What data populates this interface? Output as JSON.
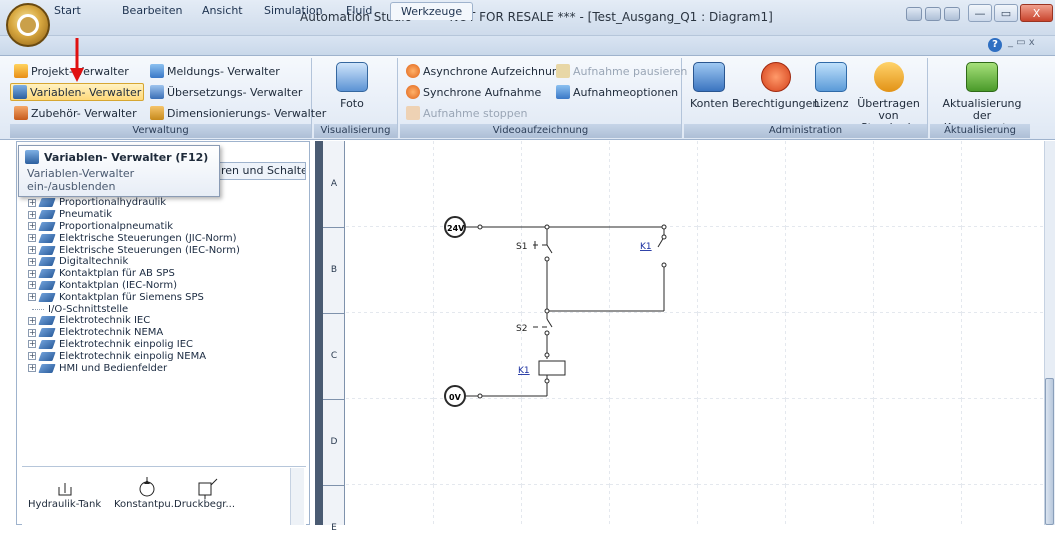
{
  "window": {
    "title": "Automation Studio™  *** NOT FOR RESALE ***   - [Test_Ausgang_Q1 : Diagram1]",
    "minimize": "—",
    "maximize": "▭",
    "close": "X"
  },
  "menu_tabs": [
    "Start",
    "Bearbeiten",
    "Ansicht",
    "Simulation",
    "Fluid",
    "Werkzeuge"
  ],
  "active_tab": "Werkzeuge",
  "ribbon": {
    "verwaltung": {
      "label": "Verwaltung",
      "items": [
        "Projekt- Verwalter",
        "Meldungs- Verwalter",
        "Variablen- Verwalter",
        "Übersetzungs- Verwalter",
        "Zubehör- Verwalter",
        "Dimensionierungs- Verwalter"
      ]
    },
    "visualisierung": {
      "label": "Visualisierung",
      "foto": "Foto"
    },
    "videoaufzeichnung": {
      "label": "Videoaufzeichnung",
      "async": "Asynchrone Aufzeichnung",
      "pause": "Aufnahme pausieren",
      "sync": "Synchrone Aufnahme",
      "options": "Aufnahmeoptionen",
      "stop": "Aufnahme stoppen"
    },
    "administration": {
      "label": "Administration",
      "konten": "Konten",
      "berechtigungen": "Berechtigungen",
      "lizenz": "Lizenz",
      "uebertragen1": "Übertragen",
      "uebertragen2": "von Standards"
    },
    "aktualisierung": {
      "label": "Aktualisierung",
      "btn1": "Aktualisierung",
      "btn2": "der Komponenten"
    }
  },
  "tooltip": {
    "title": "Variablen- Verwalter (F12)",
    "line1": "Variablen-Verwalter",
    "line2": "ein-/ausblenden"
  },
  "panel_tab": "ren und Schalter",
  "tree": [
    {
      "label": "Proportionalhydraulik",
      "leaf": false
    },
    {
      "label": "Pneumatik",
      "leaf": false
    },
    {
      "label": "Proportionalpneumatik",
      "leaf": false
    },
    {
      "label": "Elektrische Steuerungen (JIC-Norm)",
      "leaf": false
    },
    {
      "label": "Elektrische Steuerungen (IEC-Norm)",
      "leaf": false
    },
    {
      "label": "Digitaltechnik",
      "leaf": false
    },
    {
      "label": "Kontaktplan für AB SPS",
      "leaf": false
    },
    {
      "label": "Kontaktplan (IEC-Norm)",
      "leaf": false
    },
    {
      "label": "Kontaktplan für Siemens SPS",
      "leaf": false
    },
    {
      "label": "I/O-Schnittstelle",
      "leaf": true
    },
    {
      "label": "Elektrotechnik IEC",
      "leaf": false
    },
    {
      "label": "Elektrotechnik NEMA",
      "leaf": false
    },
    {
      "label": "Elektrotechnik einpolig IEC",
      "leaf": false
    },
    {
      "label": "Elektrotechnik einpolig NEMA",
      "leaf": false
    },
    {
      "label": "HMI und Bedienfelder",
      "leaf": false
    }
  ],
  "library": [
    "Hydraulik-Tank",
    "Konstantpu...",
    "Druckbegr..."
  ],
  "row_labels": [
    "A",
    "B",
    "C",
    "D",
    "E"
  ],
  "diagram": {
    "supply_top": "24V",
    "supply_bottom": "0V",
    "s1": "S1",
    "s2": "S2",
    "k1_contact": "K1",
    "k1_coil": "K1"
  }
}
